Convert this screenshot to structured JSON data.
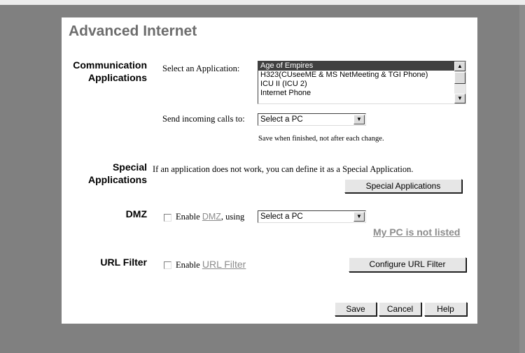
{
  "page": {
    "title": "Advanced Internet"
  },
  "communication": {
    "label_line1": "Communication",
    "label_line2": "Applications",
    "select_app_label": "Select an Application:",
    "apps": [
      "Age of Empires",
      "H323(CUseeME & MS NetMeeting & TGI Phone)",
      "ICU II (ICU 2)",
      "Internet Phone"
    ],
    "selected_app": "Age of Empires",
    "send_calls_label": "Send incoming calls to:",
    "send_calls_value": "Select a PC",
    "save_note": "Save when finished, not after each change."
  },
  "special": {
    "label_line1": "Special",
    "label_line2": "Applications",
    "description": "If an application does not work, you can define it as a Special Application.",
    "button_label": "Special Applications"
  },
  "dmz": {
    "label": "DMZ",
    "enable_prefix": "Enable ",
    "link_text": "DMZ",
    "enable_suffix": ", using",
    "select_value": "Select a PC",
    "not_listed_link": "My PC is not listed"
  },
  "url_filter": {
    "label": "URL Filter",
    "enable_prefix": "Enable ",
    "link_text": "URL Filter",
    "button_label": "Configure URL Filter"
  },
  "footer": {
    "save": "Save",
    "cancel": "Cancel",
    "help": "Help"
  }
}
